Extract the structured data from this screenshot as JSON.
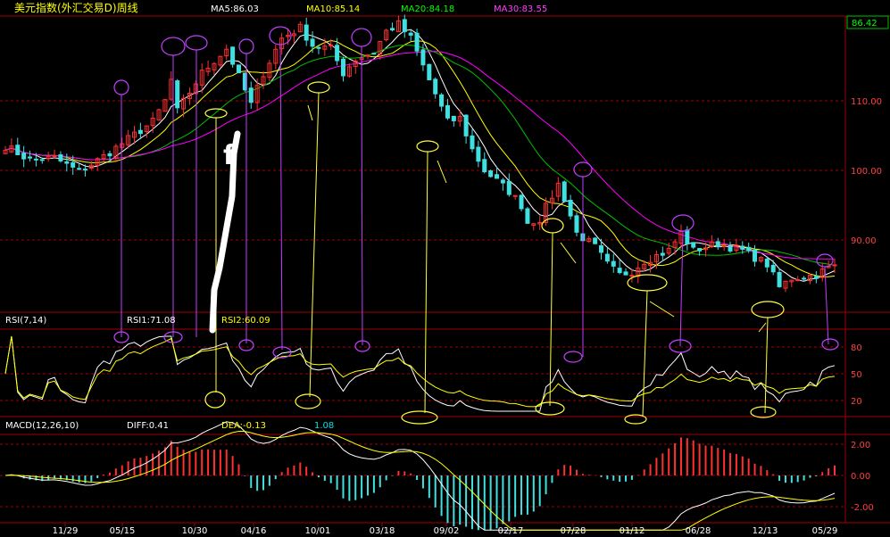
{
  "header": {
    "title": "美元指数(外汇交易D)周线",
    "ma5": "MA5:86.03",
    "ma10": "MA10:85.14",
    "ma20": "MA20:84.18",
    "ma30": "MA30:83.55",
    "last_price": "86.42"
  },
  "colors": {
    "background": "#000000",
    "frame": "#a00000",
    "up": "#ff3030",
    "down": "#40e0e0",
    "ma5": "#ffffff",
    "ma10": "#ffff00",
    "ma20": "#00c000",
    "ma30": "#ff00ff",
    "annotation_yellow": "#ffff40",
    "annotation_magenta": "#c040ff",
    "hand_drawn": "#ffffff"
  },
  "rsi_panel": {
    "label": "RSI(7,14)",
    "rsi1": "RSI1:71.08",
    "rsi2": "RSI2:60.09"
  },
  "macd_panel": {
    "label": "MACD(12,26,10)",
    "diff": "DIFF:0.41",
    "dea": "DEA:-0.13",
    "macd": "1.08"
  },
  "hand_mark": "f",
  "chart_data": [
    {
      "type": "candlestick",
      "title": "美元指数(外汇交易D)周线",
      "y_ticks": [
        "110.00",
        "100.00",
        "90.00"
      ],
      "x_ticks": [
        "11/29",
        "05/15",
        "10/30",
        "04/16",
        "10/01",
        "03/18",
        "09/02",
        "02/17",
        "07/28",
        "01/12",
        "06/28",
        "12/13",
        "05/29"
      ],
      "close_path": [
        [
          0,
          103.5
        ],
        [
          4,
          101.5
        ],
        [
          8,
          101.8
        ],
        [
          12,
          99.8
        ],
        [
          16,
          102
        ],
        [
          20,
          104.5
        ],
        [
          24,
          107
        ],
        [
          26,
          110
        ],
        [
          27,
          113
        ],
        [
          28,
          108.5
        ],
        [
          32,
          114
        ],
        [
          36,
          117.5
        ],
        [
          38,
          113.5
        ],
        [
          40,
          109.5
        ],
        [
          42,
          114
        ],
        [
          45,
          119
        ],
        [
          48,
          120.5
        ],
        [
          50,
          118
        ],
        [
          53,
          117.5
        ],
        [
          55,
          114
        ],
        [
          57,
          116
        ],
        [
          60,
          117
        ],
        [
          62,
          120
        ],
        [
          64,
          121
        ],
        [
          66,
          119
        ],
        [
          70,
          111
        ],
        [
          72,
          107
        ],
        [
          74,
          107.5
        ],
        [
          76,
          103
        ],
        [
          78,
          100
        ],
        [
          80,
          98.5
        ],
        [
          82,
          97
        ],
        [
          84,
          95
        ],
        [
          85,
          92.5
        ],
        [
          87,
          93
        ],
        [
          90,
          98
        ],
        [
          91,
          96
        ],
        [
          93,
          91
        ],
        [
          96,
          89
        ],
        [
          98,
          86.5
        ],
        [
          100,
          85
        ],
        [
          102,
          85.5
        ],
        [
          104,
          87
        ],
        [
          108,
          88.5
        ],
        [
          110,
          91
        ],
        [
          112,
          88.5
        ],
        [
          116,
          89.5
        ],
        [
          120,
          88.5
        ],
        [
          124,
          86.5
        ],
        [
          126,
          83.2
        ],
        [
          128,
          84.5
        ],
        [
          132,
          85
        ],
        [
          134,
          86
        ],
        [
          135,
          86.42
        ]
      ],
      "ma5": "86.03",
      "ma10": "85.14",
      "ma20": "84.18",
      "ma30": "83.55",
      "last": "86.42"
    },
    {
      "type": "line",
      "title": "RSI(7,14)",
      "y_ticks": [
        "80",
        "50",
        "20"
      ],
      "series": [
        {
          "name": "RSI1",
          "last": "71.08"
        },
        {
          "name": "RSI2",
          "last": "60.09"
        }
      ]
    },
    {
      "type": "bar",
      "title": "MACD(12,26,10)",
      "y_ticks": [
        "2.00",
        "0.00",
        "-2.00"
      ],
      "diff": "0.41",
      "dea": "-0.13",
      "macd": "1.08"
    }
  ]
}
